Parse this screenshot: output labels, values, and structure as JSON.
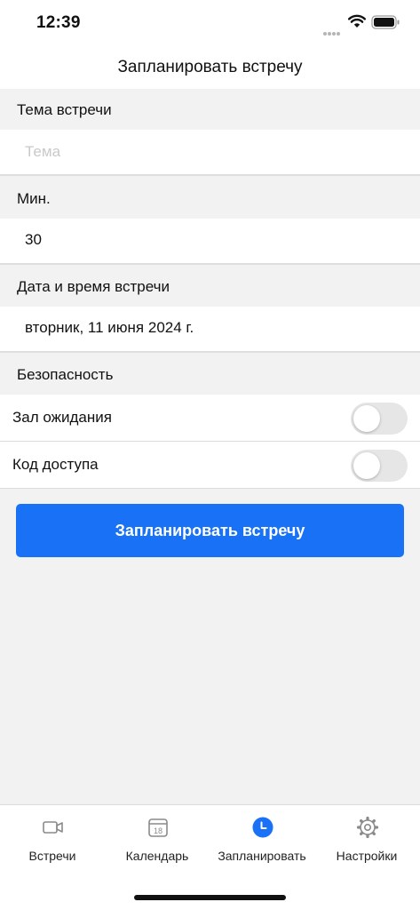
{
  "status_bar": {
    "time": "12:39"
  },
  "header": {
    "title": "Запланировать встречу"
  },
  "sections": {
    "topic": {
      "label": "Тема встречи",
      "placeholder": "Тема",
      "value": ""
    },
    "duration": {
      "label": "Мин.",
      "value": "30"
    },
    "datetime": {
      "label": "Дата и время встречи",
      "value": "вторник, 11 июня 2024 г."
    },
    "security": {
      "label": "Безопасность",
      "waiting_room": {
        "label": "Зал ожидания",
        "enabled": false
      },
      "passcode": {
        "label": "Код доступа",
        "enabled": false
      }
    }
  },
  "schedule_button": {
    "label": "Запланировать встречу"
  },
  "tabs": [
    {
      "label": "Встречи",
      "icon": "video-camera-icon",
      "active": false
    },
    {
      "label": "Календарь",
      "icon": "calendar-icon",
      "badge": "18",
      "active": false
    },
    {
      "label": "Запланировать",
      "icon": "clock-icon",
      "active": true
    },
    {
      "label": "Настройки",
      "icon": "gear-icon",
      "active": false
    }
  ],
  "colors": {
    "accent": "#1971f5",
    "inactive_icon": "#8a8a8a",
    "background": "#f2f2f2"
  }
}
